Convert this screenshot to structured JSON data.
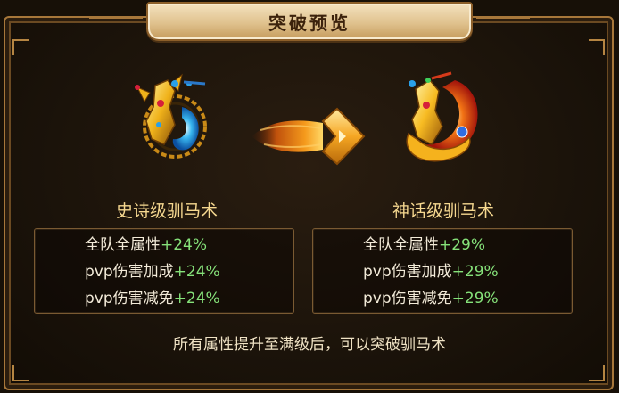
{
  "title": "突破预览",
  "before": {
    "name": "史诗级驯马术",
    "icon": "blue-gold-dragon-emblem-icon",
    "stats": [
      {
        "label": "全队全属性",
        "value": "+24%"
      },
      {
        "label": "pvp伤害加成",
        "value": "+24%"
      },
      {
        "label": "pvp伤害减免",
        "value": "+24%"
      }
    ]
  },
  "arrow_icon": "fire-arrow-icon",
  "after": {
    "name": "神话级驯马术",
    "icon": "red-gold-dragon-emblem-icon",
    "stats": [
      {
        "label": "全队全属性",
        "value": "+29%"
      },
      {
        "label": "pvp伤害加成",
        "value": "+29%"
      },
      {
        "label": "pvp伤害减免",
        "value": "+29%"
      }
    ]
  },
  "footer_note": "所有属性提升至满级后，可以突破驯马术",
  "colors": {
    "name": "#f6d890",
    "stat_text": "#f2ead8",
    "stat_value": "#86e27a",
    "frame": "#a7773a"
  }
}
